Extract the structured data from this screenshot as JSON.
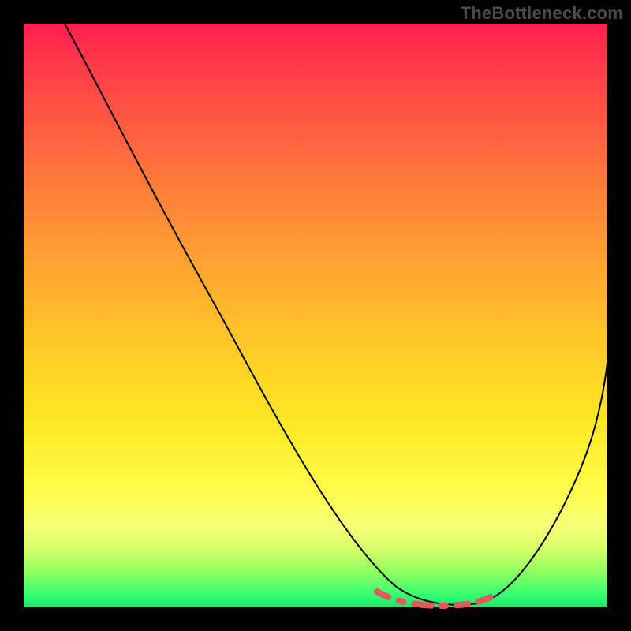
{
  "watermark": "TheBottleneck.com",
  "chart_data": {
    "type": "line",
    "title": "",
    "xlabel": "",
    "ylabel": "",
    "xlim": [
      0,
      100
    ],
    "ylim": [
      0,
      100
    ],
    "grid": false,
    "legend": false,
    "background_gradient": {
      "direction": "vertical",
      "stops": [
        {
          "pos": 0.0,
          "color": "#ff1f4f"
        },
        {
          "pos": 0.5,
          "color": "#ffc628"
        },
        {
          "pos": 0.85,
          "color": "#fcff55"
        },
        {
          "pos": 1.0,
          "color": "#16e66a"
        }
      ]
    },
    "series": [
      {
        "name": "bottleneck-curve",
        "x": [
          7,
          15,
          25,
          35,
          45,
          55,
          62,
          66,
          70,
          74,
          78,
          82,
          88,
          94,
          100
        ],
        "y": [
          100,
          88,
          72,
          56,
          40,
          22,
          10,
          4,
          1,
          0,
          0,
          1,
          7,
          22,
          42
        ],
        "stroke": "#000000"
      }
    ],
    "highlight_segment": {
      "name": "optimal-range-dash",
      "x": [
        62,
        66,
        70,
        74,
        78,
        82
      ],
      "y": [
        4,
        1.5,
        0.5,
        0.3,
        0.5,
        2
      ],
      "stroke": "#e05a5a",
      "style": "dashed"
    }
  }
}
